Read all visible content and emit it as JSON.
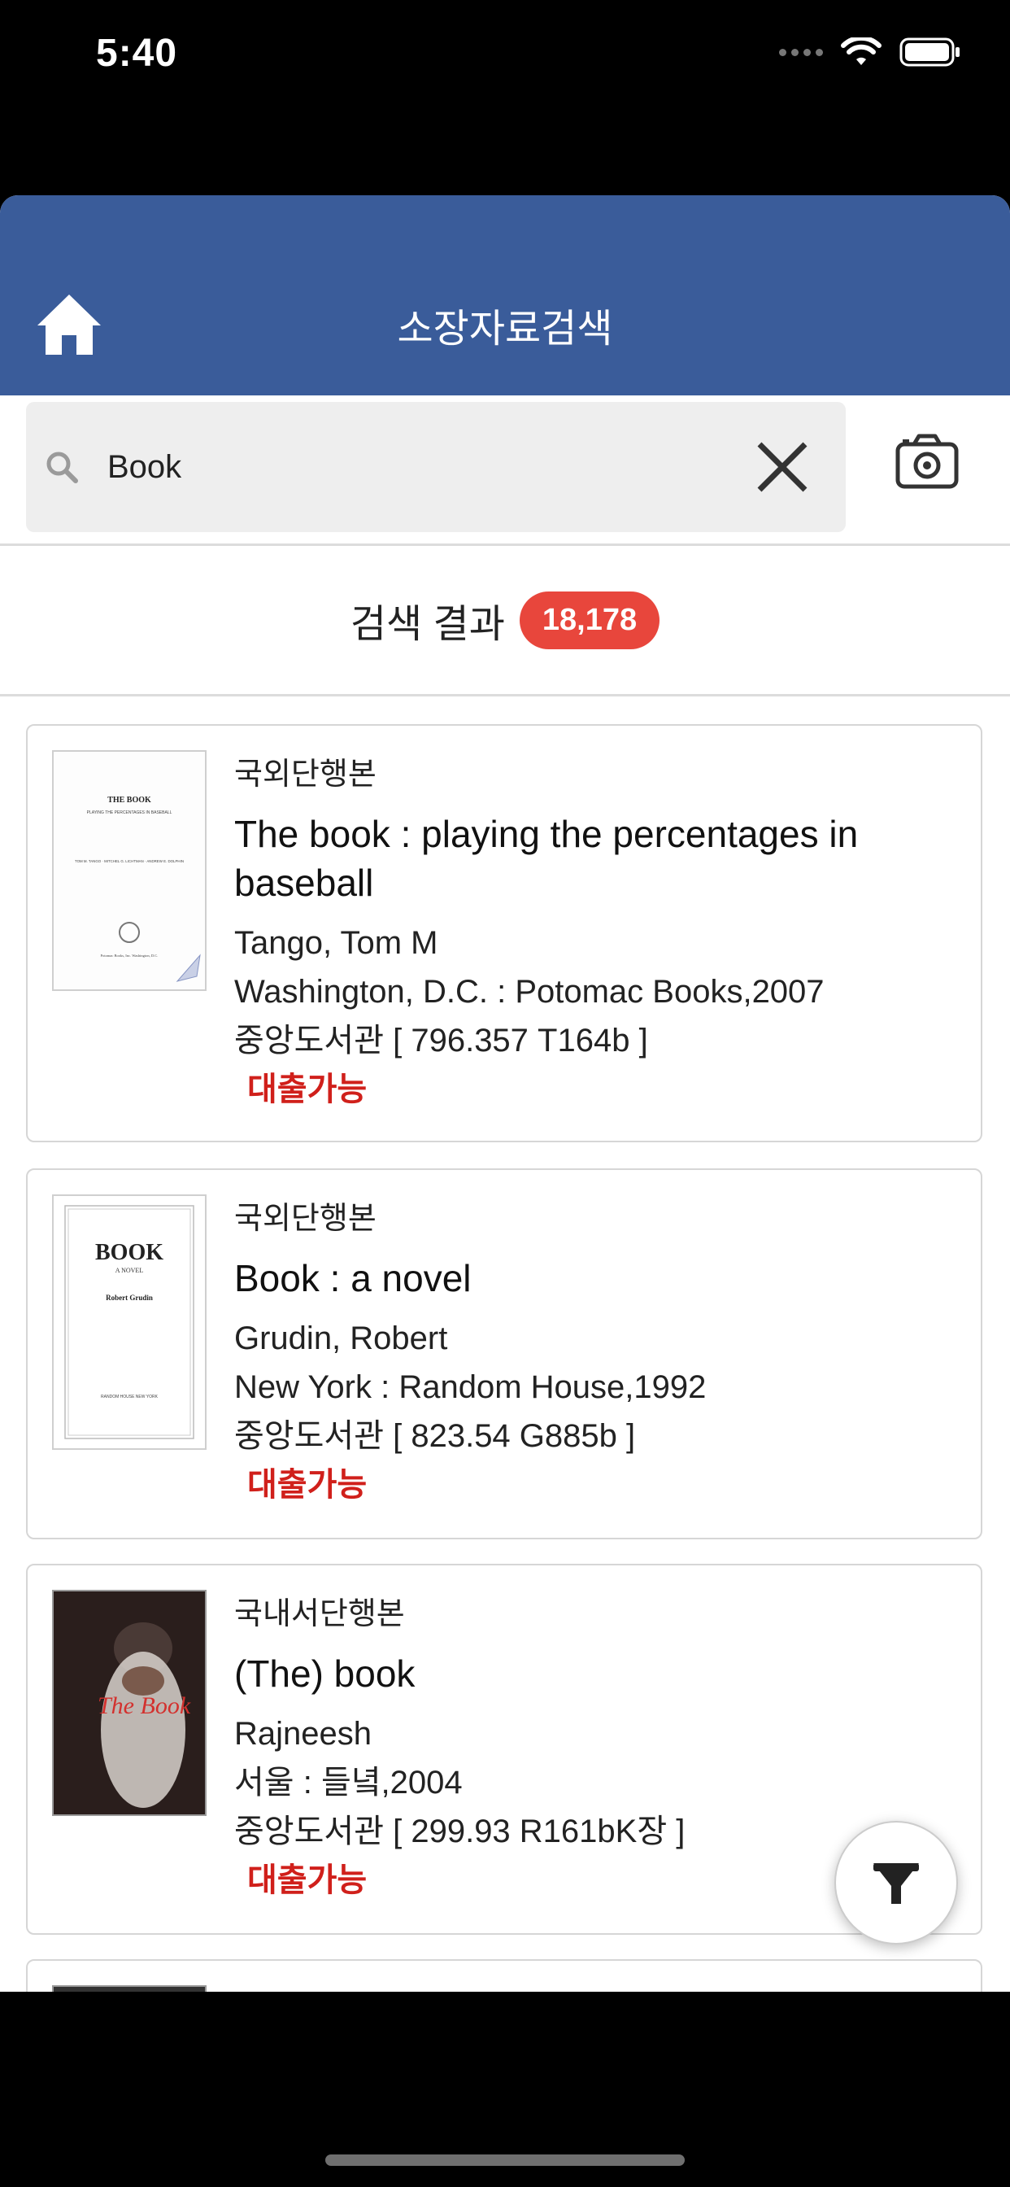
{
  "status_bar": {
    "time": "5:40"
  },
  "header": {
    "title": "소장자료검색"
  },
  "search": {
    "value": "Book",
    "placeholder": ""
  },
  "results": {
    "label": "검색 결과",
    "count": "18,178"
  },
  "books": [
    {
      "type": "국외단행본",
      "title": "The book : playing the percentages in baseball",
      "author": "Tango, Tom M",
      "publisher": "Washington, D.C. : Potomac Books,2007",
      "location": "중앙도서관 [ 796.357 T164b ]",
      "status": "대출가능",
      "cover": {
        "title": "THE BOOK",
        "subtitle": "PLAYING THE PERCENTAGES IN BASEBALL",
        "authors": "TOM M. TANGO · MITCHEL G. LICHTMAN · ANDREW E. DOLPHIN",
        "imprint": "Potomac Books, Inc. Washington, D.C."
      }
    },
    {
      "type": "국외단행본",
      "title": "Book : a novel",
      "author": "Grudin, Robert",
      "publisher": "New York : Random House,1992",
      "location": "중앙도서관 [ 823.54 G885b ]",
      "status": "대출가능",
      "cover": {
        "title": "BOOK",
        "subtitle": "A NOVEL",
        "authors": "Robert Grudin",
        "imprint": "RANDOM HOUSE NEW YORK"
      }
    },
    {
      "type": "국내서단행본",
      "title": "(The) book",
      "author": "Rajneesh",
      "publisher": "서울 : 들녘,2004",
      "location": "중앙도서관 [ 299.93 R161bK장 ]",
      "status": "대출가능",
      "cover": {
        "title": "The Book"
      }
    }
  ],
  "colors": {
    "header": "#3a5c9a",
    "badge": "#e8463c",
    "available": "#d0201b"
  }
}
